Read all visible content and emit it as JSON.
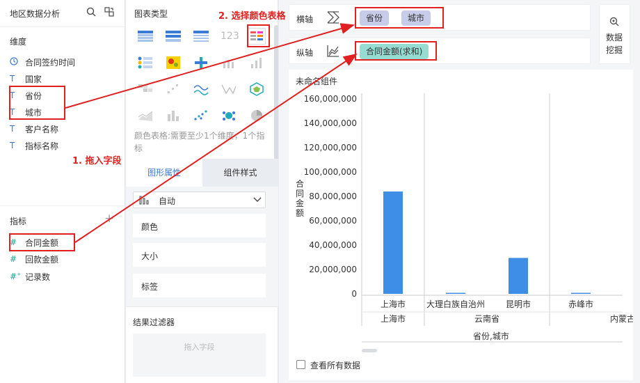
{
  "left": {
    "title": "地区数据分析",
    "dim_header": "维度",
    "dimensions": [
      "合同签约时间",
      "国家",
      "省份",
      "城市",
      "客户名称",
      "指标名称"
    ],
    "measure_header": "指标",
    "measures": [
      "合同金额",
      "回款金额",
      "记录数"
    ]
  },
  "mid": {
    "chart_type_title": "图表类型",
    "hint": "颜色表格:需要至少1个维度，1个指标",
    "tab_graph": "图形属性",
    "tab_style": "组件样式",
    "auto": "自动",
    "attr_color": "颜色",
    "attr_size": "大小",
    "attr_label": "标签",
    "filter_title": "结果过滤器",
    "filter_placeholder": "拖入字段"
  },
  "axis": {
    "x_label": "横轴",
    "x_pills": [
      "省份",
      "城市"
    ],
    "y_label": "纵轴",
    "y_pill": "合同金额(求和)",
    "mining": [
      "数据",
      "挖掘"
    ]
  },
  "annotations": {
    "step1": "1. 拖入字段",
    "step2": "2. 选择颜色表格"
  },
  "widget": {
    "title": "未命名组件",
    "show_all": "查看所有数据"
  },
  "chart_data": {
    "type": "bar",
    "ylabel": "合同金额",
    "xlabel": "省份,城市",
    "ylim": [
      0,
      160000000
    ],
    "y_ticks": [
      "160,000,000",
      "140,000,000",
      "120,000,000",
      "100,000,000",
      "80,000,000",
      "60,000,000",
      "40,000,000",
      "20,000,000",
      "0"
    ],
    "groups": [
      {
        "province": "上海市",
        "cities": [
          {
            "city": "上海市",
            "value": 84000000
          }
        ]
      },
      {
        "province": "云南省",
        "cities": [
          {
            "city": "大理白族自治州",
            "value": 800000
          },
          {
            "city": "昆明市",
            "value": 29500000
          }
        ]
      },
      {
        "province": "内蒙古",
        "cities": [
          {
            "city": "赤峰市",
            "value": 800000
          }
        ]
      }
    ],
    "colors": {
      "bar": "#3e8de6"
    }
  }
}
